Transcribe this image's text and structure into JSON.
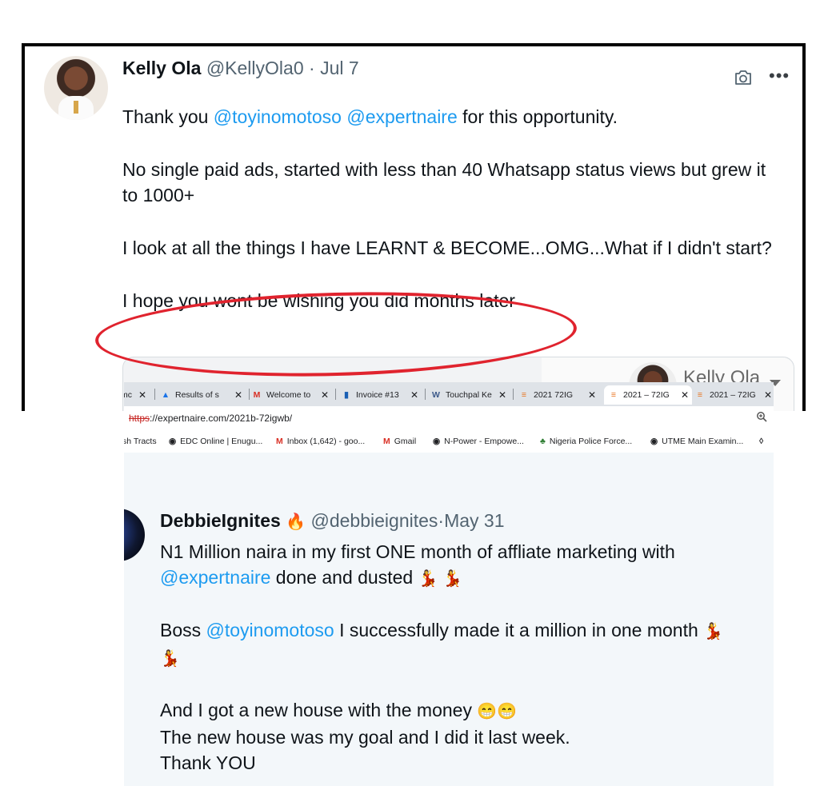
{
  "tweet1": {
    "name": "Kelly Ola",
    "handle": "@KellyOla0",
    "date": "Jul 7",
    "separator": "·",
    "more": "•••",
    "line1_pre": "Thank you ",
    "line1_mention1": "@toyinomotoso",
    "line1_mention2": "@expertnaire",
    "line1_post": " for this opportunity.",
    "para2": "No single paid ads, started with less than 40 Whatsapp status views but grew it to 1000+",
    "para3": "I look at all the things I have LEARNT & BECOME...OMG...What if I didn't start?",
    "para4": "I hope you wont be wishing you did months later",
    "embed_name": "Kelly Ola",
    "icons": {
      "camera": "camera-icon",
      "more": "more-icon"
    },
    "highlight_color": "#e0232e"
  },
  "browser": {
    "tabs": [
      {
        "label": "mc",
        "icon": ""
      },
      {
        "label": "Results of s",
        "icon": "▲"
      },
      {
        "label": "Welcome to",
        "icon": "M"
      },
      {
        "label": "Invoice #13",
        "icon": "▮"
      },
      {
        "label": "Touchpal Ke",
        "icon": "W"
      },
      {
        "label": "2021 72IG",
        "icon": "≡"
      },
      {
        "label": "2021 – 72IG",
        "icon": "≡"
      },
      {
        "label": "2021 – 72IG",
        "icon": "≡"
      }
    ],
    "close_glyph": "✕",
    "url_scheme": "https",
    "url_rest": "://expertnaire.com/2021b-72igwb/",
    "bookmarks": [
      {
        "label": "sh Tracts",
        "icon": ""
      },
      {
        "label": "EDC Online | Enugu...",
        "icon": "◉"
      },
      {
        "label": "Inbox (1,642) - goo...",
        "icon": "M"
      },
      {
        "label": "Gmail",
        "icon": "M"
      },
      {
        "label": "N-Power - Empowe...",
        "icon": "◉"
      },
      {
        "label": "Nigeria Police Force...",
        "icon": "♣"
      },
      {
        "label": "UTME Main Examin...",
        "icon": "◉"
      },
      {
        "label": "",
        "icon": "◊"
      }
    ]
  },
  "tweet2": {
    "name": "DebbieIgnites",
    "name_emoji": "🔥",
    "handle": "@debbieignites",
    "separator": "·",
    "date": "May 31",
    "line1": "N1 Million naira in my first ONE month of affliate marketing with",
    "line2_mention": "@expertnaire",
    "line2_post": " done and dusted ",
    "line2_emoji": "💃 💃",
    "line3_pre": "Boss ",
    "line3_mention": "@toyinomotoso",
    "line3_post": " I successfully made it a million in one month ",
    "line3_emoji": "💃 💃",
    "line3_emoji2": "💃",
    "line4": "And I got a new house with the money ",
    "line4_emoji": "😁😁",
    "line5": "The new house was my goal and I did it last week.",
    "line6": "Thank YOU"
  }
}
